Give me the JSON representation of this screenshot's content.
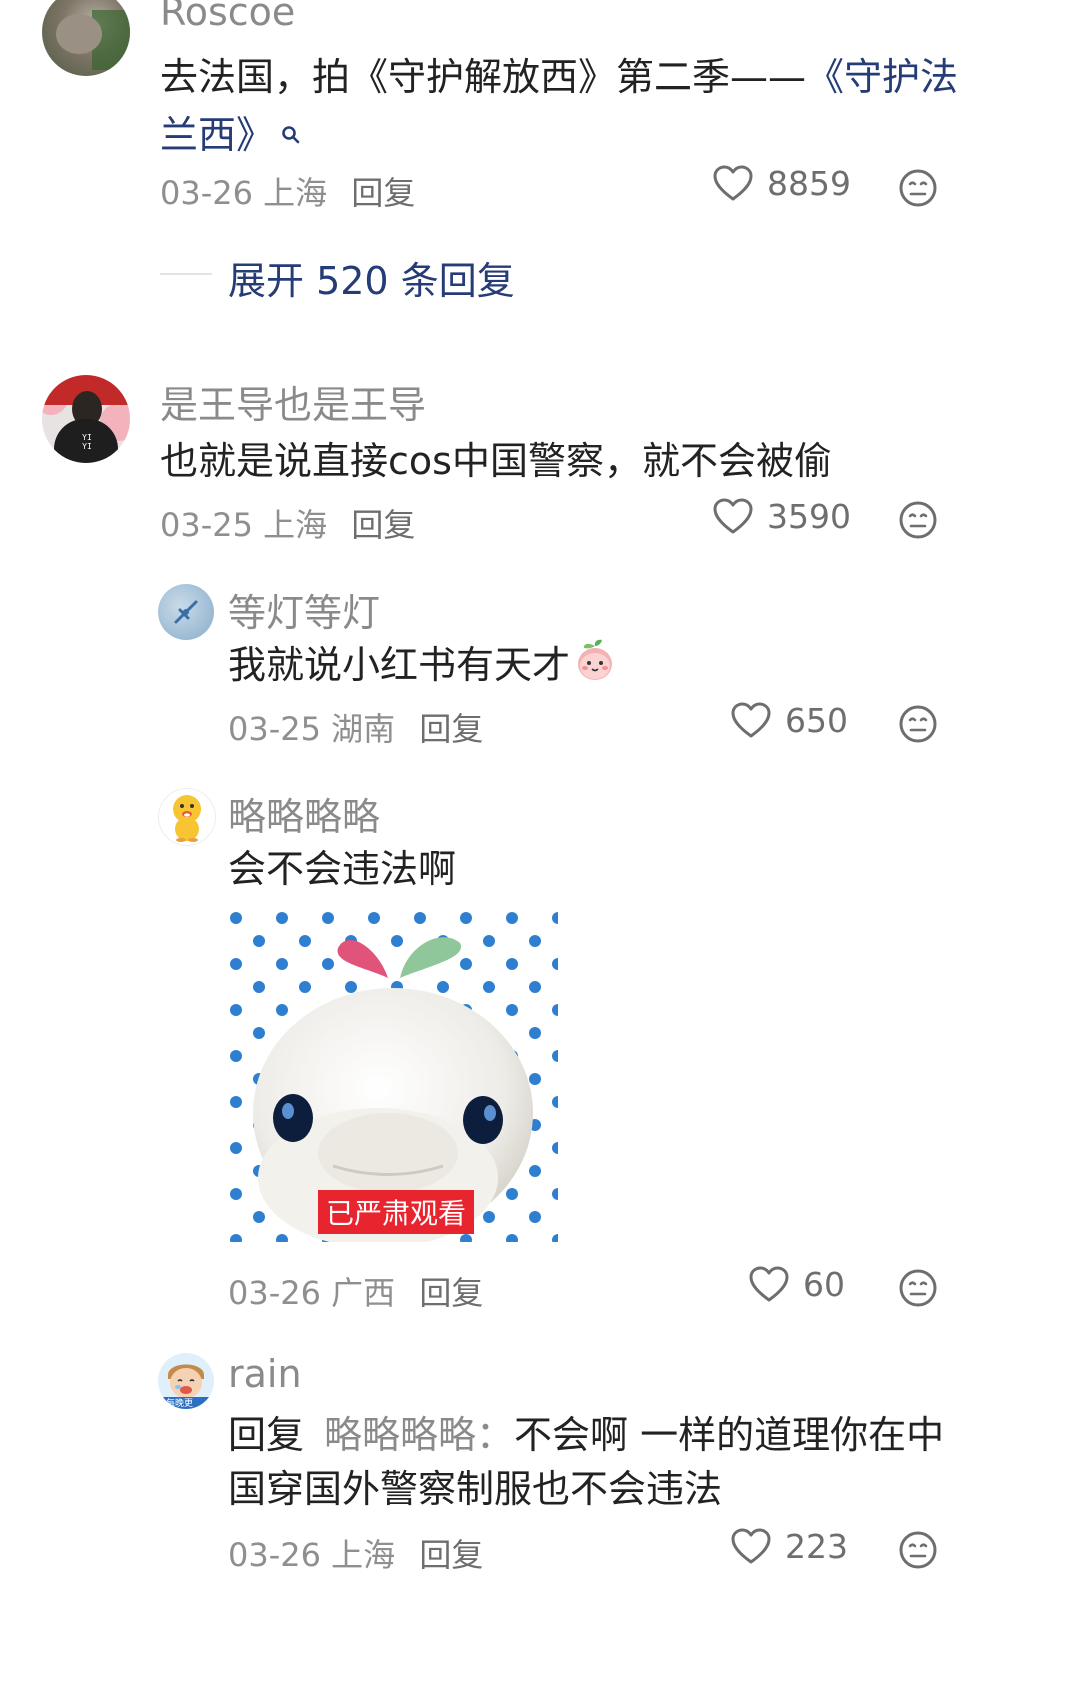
{
  "comments": [
    {
      "username": "Roscoe",
      "text_plain": "去法国，拍《守护解放西》第二季——",
      "text_link": "《守护法兰西》",
      "date": "03-26",
      "location": "上海",
      "reply_label": "回复",
      "likes": "8859",
      "expand_label": "展开 520 条回复"
    },
    {
      "username": "是王导也是王导",
      "text": "也就是说直接cos中国警察，就不会被偷",
      "date": "03-25",
      "location": "上海",
      "reply_label": "回复",
      "likes": "3590",
      "avatar_text": "YI YI",
      "replies": [
        {
          "username": "等灯等灯",
          "text": "我就说小红书有天才",
          "date": "03-25",
          "location": "湖南",
          "reply_label": "回复",
          "likes": "650"
        },
        {
          "username": "略略略略",
          "text": "会不会违法啊",
          "sticker_caption": "已严肃观看",
          "date": "03-26",
          "location": "广西",
          "reply_label": "回复",
          "likes": "60"
        },
        {
          "username": "rain",
          "reply_prefix": "回复",
          "reply_to": "略略略略",
          "reply_colon": "：",
          "text": "不会啊 一样的道理你在中国穿国外警察制服也不会违法",
          "date": "03-26",
          "location": "上海",
          "reply_label": "回复",
          "likes": "223",
          "avatar_text": "每晚更"
        }
      ]
    }
  ],
  "icons": {
    "like": "heart-outline-icon",
    "react": "smiley-face-icon",
    "search": "search-icon"
  },
  "colors": {
    "link": "#253c76",
    "username": "#8a8a8a",
    "meta": "#8f8f8f",
    "sticker_caption_bg": "#e8242e"
  }
}
